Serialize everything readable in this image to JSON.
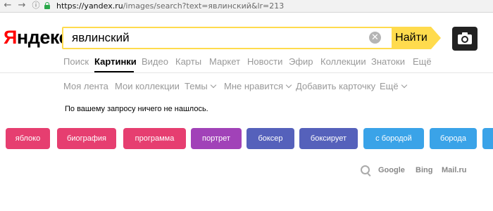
{
  "browser": {
    "back_icon": "arrow-left-icon",
    "forward_icon": "arrow-right-icon",
    "info_icon": "info-circle-icon",
    "lock_icon": "lock-icon",
    "url_host": "https://yandex.ru",
    "url_rest": "/images/search?text=явлинский&lr=213"
  },
  "header": {
    "logo_first": "Я",
    "logo_rest": "ндекс",
    "search_value": "явлинский",
    "clear_icon": "clear-icon",
    "find_label": "Найти",
    "camera_icon": "camera-icon"
  },
  "tabs": [
    {
      "label": "Поиск",
      "active": false
    },
    {
      "label": "Картинки",
      "active": true
    },
    {
      "label": "Видео",
      "active": false
    },
    {
      "label": "Карты",
      "active": false
    },
    {
      "label": "Маркет",
      "active": false
    },
    {
      "label": "Новости",
      "active": false
    },
    {
      "label": "Эфир",
      "active": false
    },
    {
      "label": "Коллекции",
      "active": false
    },
    {
      "label": "Знатоки",
      "active": false
    },
    {
      "label": "Ещё",
      "active": false
    }
  ],
  "subnav": [
    {
      "label": "Моя лента",
      "dropdown": false
    },
    {
      "label": "Мои коллекции",
      "dropdown": false
    },
    {
      "label": "Темы",
      "dropdown": true
    },
    {
      "label": "Мне нравится",
      "dropdown": true
    },
    {
      "label": "Добавить карточку",
      "dropdown": false
    },
    {
      "label": "Ещё",
      "dropdown": true
    }
  ],
  "message": "По вашему запросу ничего не нашлось.",
  "suggestions": [
    {
      "label": "яблоко",
      "color": "#e63e70"
    },
    {
      "label": "биография",
      "color": "#e63e70"
    },
    {
      "label": "программа",
      "color": "#e63e70"
    },
    {
      "label": "портрет",
      "color": "#a142b8"
    },
    {
      "label": "боксер",
      "color": "#5561bb"
    },
    {
      "label": "боксирует",
      "color": "#5561bb"
    },
    {
      "label": "с бородой",
      "color": "#3aa3e8"
    },
    {
      "label": "борода",
      "color": "#3aa3e8"
    },
    {
      "label": "",
      "color": "#3aa3e8"
    }
  ],
  "engines": {
    "search_icon": "search-icon",
    "items": [
      "Google",
      "Bing",
      "Mail.ru"
    ]
  },
  "colors": {
    "accent": "#ffdb4d",
    "logo_red": "#ff0000"
  }
}
